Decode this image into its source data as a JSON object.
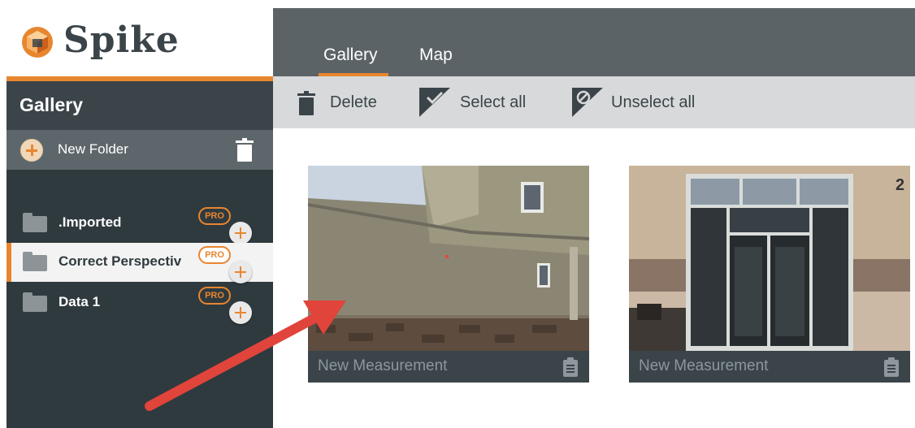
{
  "app": {
    "name": "Spike"
  },
  "sidebar": {
    "header": "Gallery",
    "new_folder_label": "New Folder",
    "folders": [
      {
        "label": ".Imported",
        "badge": "PRO",
        "selected": false
      },
      {
        "label": "Correct Perspectiv",
        "badge": "PRO",
        "selected": true
      },
      {
        "label": "Data 1",
        "badge": "PRO",
        "selected": false
      }
    ]
  },
  "tabs": [
    {
      "label": "Gallery",
      "active": true
    },
    {
      "label": "Map",
      "active": false
    }
  ],
  "toolbar": {
    "delete_label": "Delete",
    "select_all_label": "Select all",
    "unselect_all_label": "Unselect all"
  },
  "gallery": {
    "items": [
      {
        "caption": "New Measurement",
        "photo": "house-siding-photo"
      },
      {
        "caption": "New Measurement",
        "photo": "storefront-doors-photo"
      }
    ]
  },
  "colors": {
    "accent": "#e8862f",
    "sidebar_bg": "#2f3a3f",
    "tab_bar_bg": "#5b6367",
    "toolbar_bg": "#d7d9da",
    "annotation_arrow": "#e0443b"
  }
}
